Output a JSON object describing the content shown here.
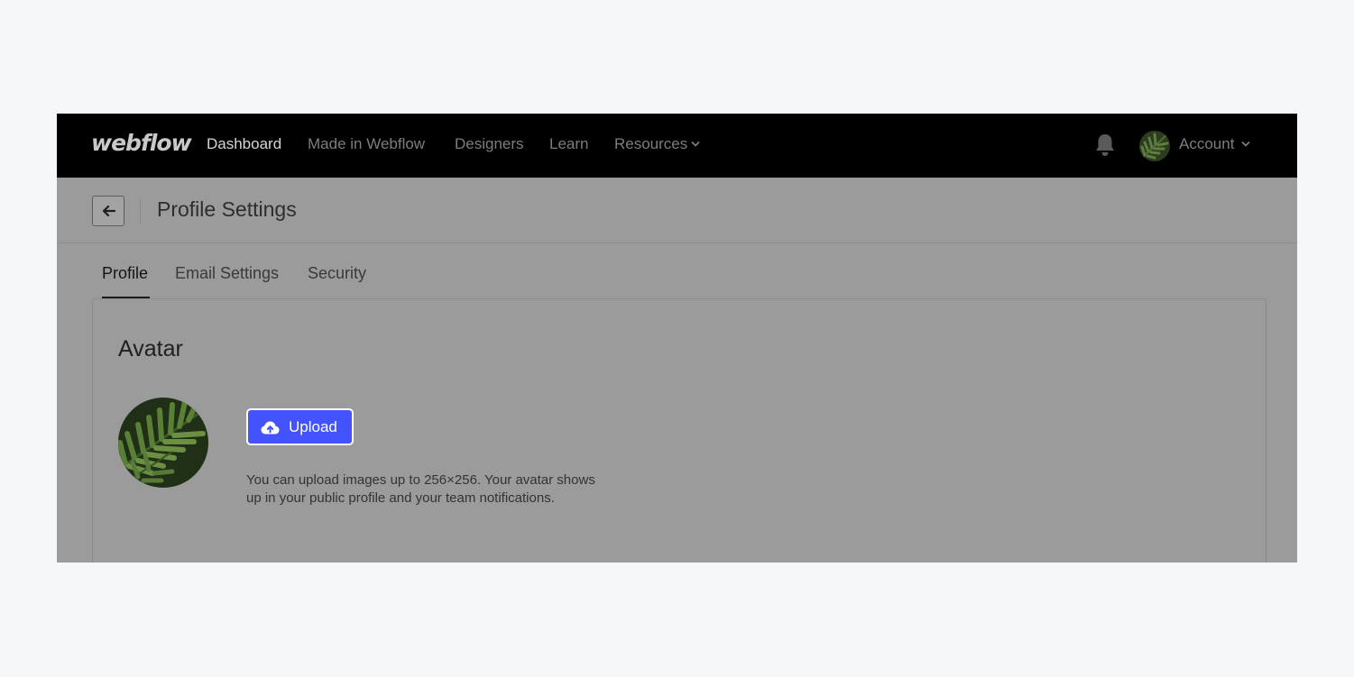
{
  "nav": {
    "logo": "webflow",
    "items": [
      {
        "label": "Dashboard",
        "active": true
      },
      {
        "label": "Made in Webflow",
        "active": false
      },
      {
        "label": "Designers",
        "active": false
      },
      {
        "label": "Learn",
        "active": false
      },
      {
        "label": "Resources",
        "active": false,
        "has_dropdown": true
      }
    ],
    "account_label": "Account"
  },
  "header": {
    "title": "Profile Settings"
  },
  "tabs": [
    {
      "label": "Profile",
      "active": true
    },
    {
      "label": "Email Settings",
      "active": false
    },
    {
      "label": "Security",
      "active": false
    }
  ],
  "avatar_section": {
    "title": "Avatar",
    "upload_label": "Upload",
    "help_text": "You can upload images up to 256×256. Your avatar shows up in your public profile and your team notifications."
  },
  "icons": {
    "back": "arrow-left-icon",
    "bell": "bell-icon",
    "upload": "cloud-upload-icon",
    "chevron": "chevron-down-icon"
  },
  "colors": {
    "nav_bg": "#000000",
    "overlay": "#9b9b9b",
    "primary": "#4353ff"
  }
}
